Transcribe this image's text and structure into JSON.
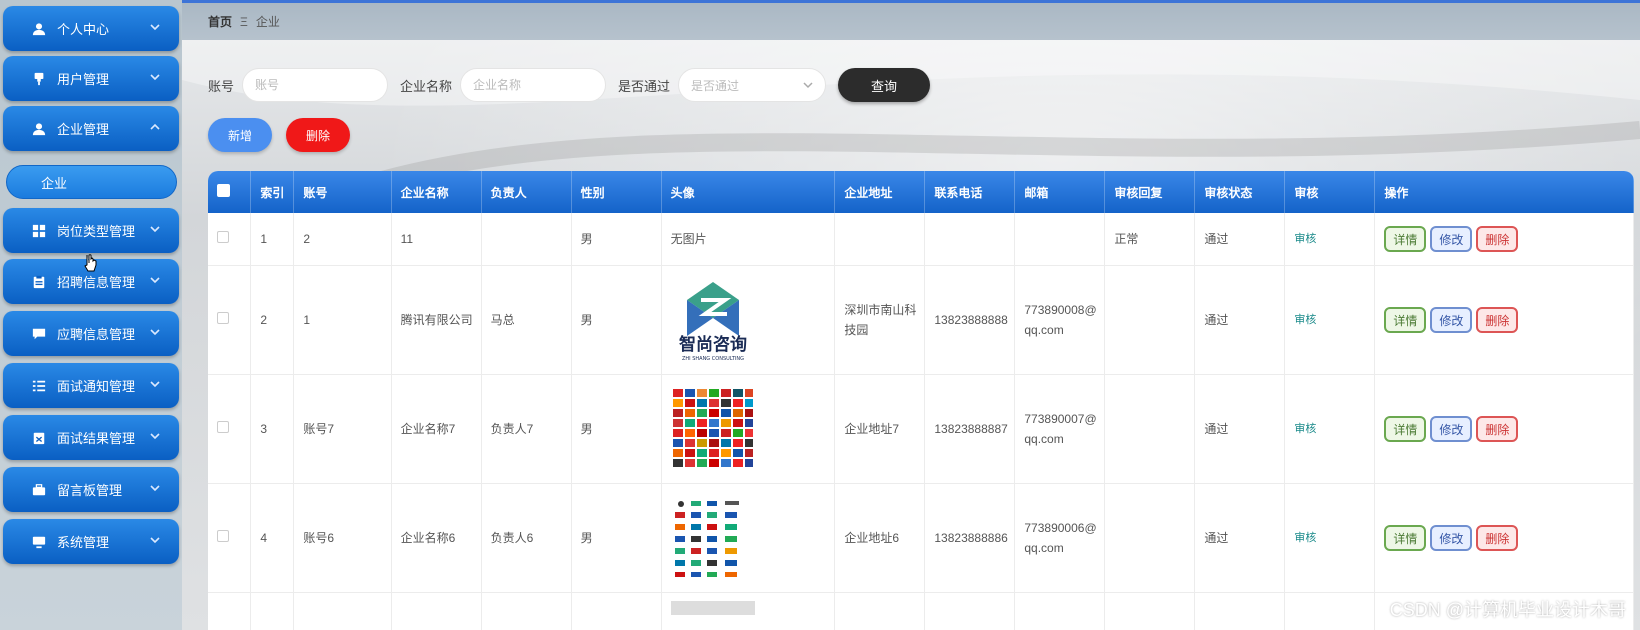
{
  "sidebar": {
    "items": [
      {
        "label": "个人中心",
        "icon": "user-icon"
      },
      {
        "label": "用户管理",
        "icon": "pin-icon"
      },
      {
        "label": "企业管理",
        "icon": "user-icon"
      },
      {
        "label": "岗位类型管理",
        "icon": "grid-icon"
      },
      {
        "label": "招聘信息管理",
        "icon": "clipboard-icon"
      },
      {
        "label": "应聘信息管理",
        "icon": "chat-icon"
      },
      {
        "label": "面试通知管理",
        "icon": "list-icon"
      },
      {
        "label": "面试结果管理",
        "icon": "clipboard-x-icon"
      },
      {
        "label": "留言板管理",
        "icon": "briefcase-icon"
      },
      {
        "label": "系统管理",
        "icon": "monitor-icon"
      }
    ],
    "active_sub": "企业"
  },
  "breadcrumb": {
    "home": "首页",
    "separator": "Ξ",
    "current": "企业"
  },
  "search": {
    "account_label": "账号",
    "account_placeholder": "账号",
    "company_label": "企业名称",
    "company_placeholder": "企业名称",
    "passed_label": "是否通过",
    "passed_placeholder": "是否通过",
    "query_button": "查询"
  },
  "actions": {
    "add": "新增",
    "delete": "删除"
  },
  "table": {
    "headers": [
      "索引",
      "账号",
      "企业名称",
      "负责人",
      "性别",
      "头像",
      "企业地址",
      "联系电话",
      "邮箱",
      "审核回复",
      "审核状态",
      "审核",
      "操作"
    ],
    "rows": [
      {
        "index": "1",
        "account": "2",
        "company": "11",
        "manager": "",
        "gender": "男",
        "avatar": "无图片",
        "address": "",
        "phone": "",
        "email": "",
        "reply": "正常",
        "status": "通过",
        "audit": "审核"
      },
      {
        "index": "2",
        "account": "1",
        "company": "腾讯有限公司",
        "manager": "马总",
        "gender": "男",
        "avatar": "logo-zhishang",
        "logo_text": "智尚咨询",
        "logo_sub": "ZHI SHANG CONSULTING",
        "address": "深圳市南山科技园",
        "phone": "13823888888",
        "email": "773890008@qq.com",
        "reply": "",
        "status": "通过",
        "audit": "审核"
      },
      {
        "index": "3",
        "account": "账号7",
        "company": "企业名称7",
        "manager": "负责人7",
        "gender": "男",
        "avatar": "logo-collage-1",
        "address": "企业地址7",
        "phone": "13823888887",
        "email": "773890007@qq.com",
        "reply": "",
        "status": "通过",
        "audit": "审核"
      },
      {
        "index": "4",
        "account": "账号6",
        "company": "企业名称6",
        "manager": "负责人6",
        "gender": "男",
        "avatar": "logo-collage-2",
        "address": "企业地址6",
        "phone": "13823888886",
        "email": "773890006@qq.com",
        "reply": "",
        "status": "通过",
        "audit": "审核"
      }
    ],
    "op_labels": {
      "detail": "详情",
      "edit": "修改",
      "remove": "删除"
    }
  },
  "watermark": "CSDN @计算机毕业设计木哥",
  "colors": {
    "sidebar_blue": "#0a5fc3",
    "header_blue": "#1463c9",
    "query_dark": "#2c2c2c",
    "add_blue": "#4b8ff0",
    "delete_red": "#f01818"
  }
}
